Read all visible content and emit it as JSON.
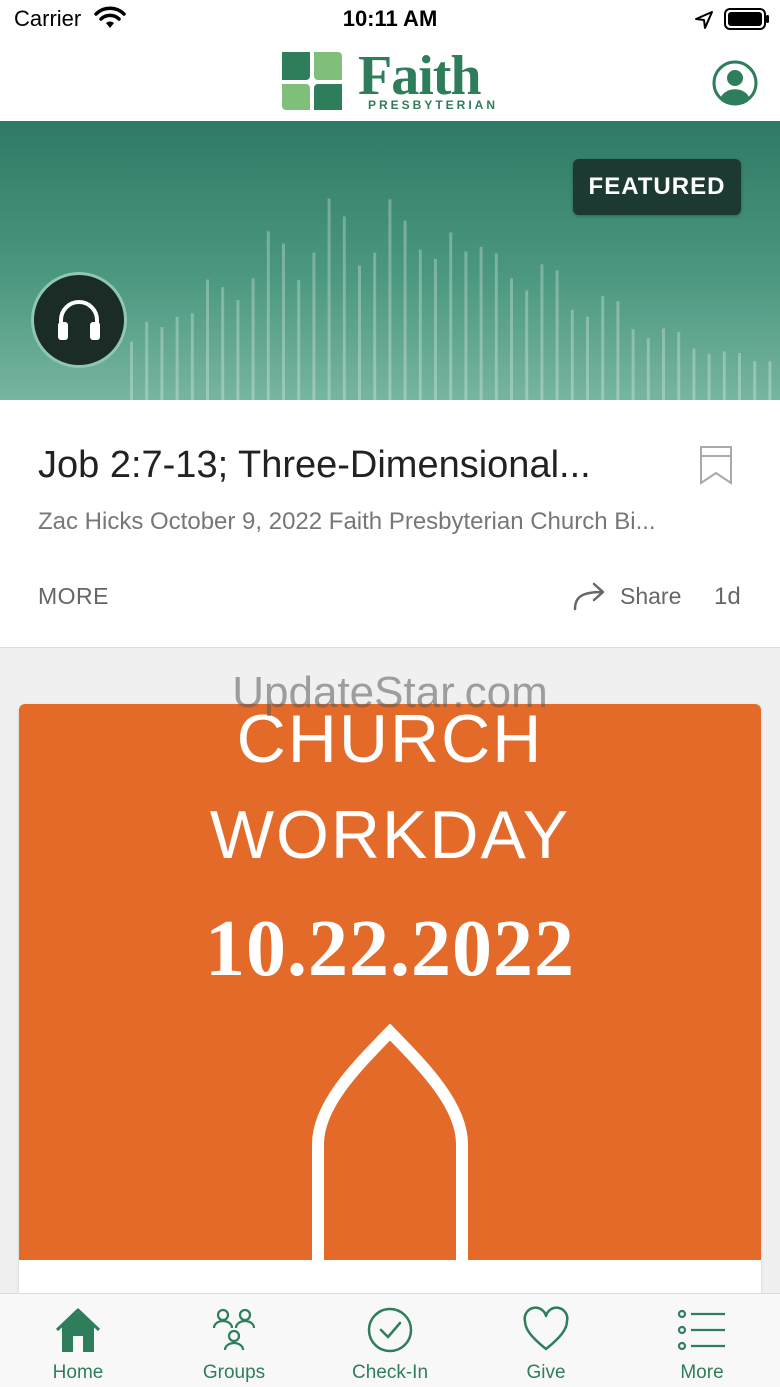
{
  "status_bar": {
    "carrier": "Carrier",
    "time": "10:11 AM"
  },
  "header": {
    "logo_word": "Faith",
    "logo_sub": "PRESBYTERIAN",
    "brand_color": "#2e7d5b"
  },
  "featured": {
    "badge": "FEATURED",
    "title": "Job 2:7-13; Three-Dimensional...",
    "subtitle": "Zac Hicks October 9, 2022 Faith Presbyterian Church Bi...",
    "more_label": "MORE",
    "share_label": "Share",
    "age": "1d"
  },
  "event": {
    "line1": "CHURCH",
    "line2": "WORKDAY",
    "date": "10.22.2022",
    "background_color": "#e36a28"
  },
  "watermark": "UpdateStar.com",
  "tabs": [
    {
      "label": "Home",
      "icon": "home-icon"
    },
    {
      "label": "Groups",
      "icon": "groups-icon"
    },
    {
      "label": "Check-In",
      "icon": "check-in-icon"
    },
    {
      "label": "Give",
      "icon": "heart-icon"
    },
    {
      "label": "More",
      "icon": "list-icon"
    }
  ]
}
